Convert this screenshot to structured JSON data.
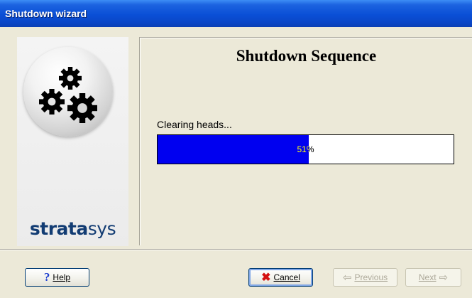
{
  "window": {
    "title": "Shutdown wizard"
  },
  "branding": {
    "logo_text_1": "strata",
    "logo_text_2": "sys",
    "logo_image": "gears-icon"
  },
  "content": {
    "heading": "Shutdown Sequence",
    "status": "Clearing heads...",
    "progress": {
      "value": 0.51,
      "label": "51%"
    }
  },
  "buttons": {
    "help": "Help",
    "cancel": "Cancel",
    "previous": "Previous",
    "next": "Next"
  },
  "colors": {
    "title_bar": "#0a4fd6",
    "progress_fill": "#0000f0",
    "window_bg": "#ece9d8",
    "brand_text": "#123c73"
  }
}
